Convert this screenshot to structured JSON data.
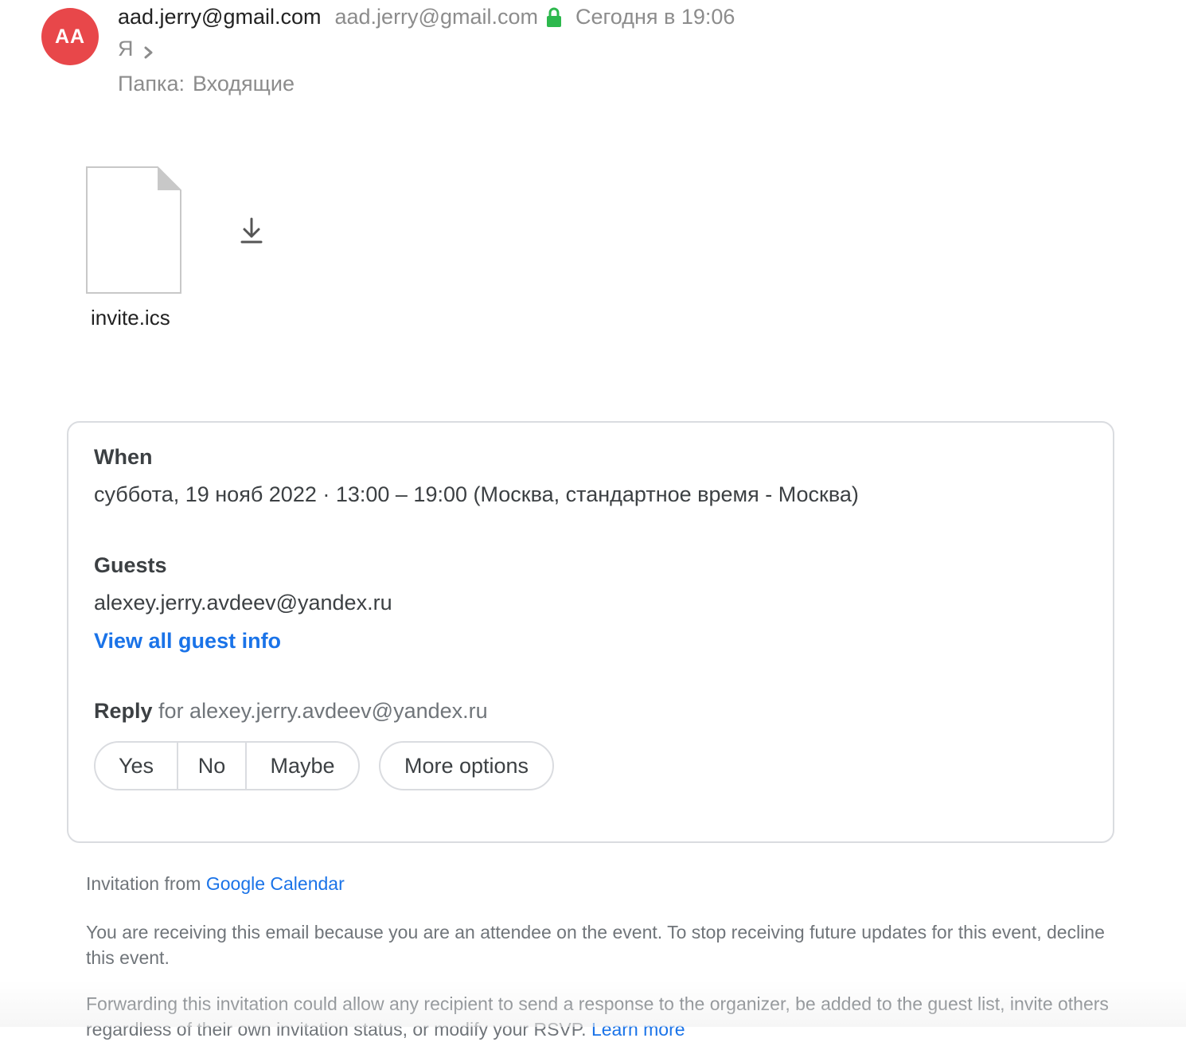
{
  "header": {
    "avatar_initials": "AA",
    "avatar_color": "#e8474a",
    "sender_name": "aad.jerry@gmail.com",
    "sender_email": "aad.jerry@gmail.com",
    "secure_icon": "lock-icon",
    "secure_color": "#2db84d",
    "date": "Сегодня в 19:06",
    "to": "Я",
    "folder_label": "Папка:",
    "folder_name": "Входящие"
  },
  "attachment": {
    "file_name": "invite.ics",
    "file_icon": "file-icon",
    "download_icon": "download-icon"
  },
  "event": {
    "when_title": "When",
    "when_value": "суббота, 19 нояб 2022 · 13:00 – 19:00 (Москва, стандартное время - Москва)",
    "guests_title": "Guests",
    "guest_email": "alexey.jerry.avdeev@yandex.ru",
    "guest_info_link": "View all guest info",
    "reply_label": "Reply",
    "reply_for": "for alexey.jerry.avdeev@yandex.ru",
    "rsvp": {
      "yes": "Yes",
      "no": "No",
      "maybe": "Maybe",
      "more_options": "More options"
    }
  },
  "footer": {
    "invitation_from": "Invitation from",
    "calendar_link": "Google Calendar",
    "notice": "You are receiving this email because you are an attendee on the event. To stop receiving future updates for this event, decline this event.",
    "forward_notice": "Forwarding this invitation could allow any recipient to send a response to the organizer, be added to the guest list, invite others regardless of their own invitation status, or modify your RSVP.",
    "learn_more": "Learn more"
  },
  "colors": {
    "link": "#1a73e8",
    "muted_text": "#8c8c8c",
    "border": "#dadce0"
  }
}
